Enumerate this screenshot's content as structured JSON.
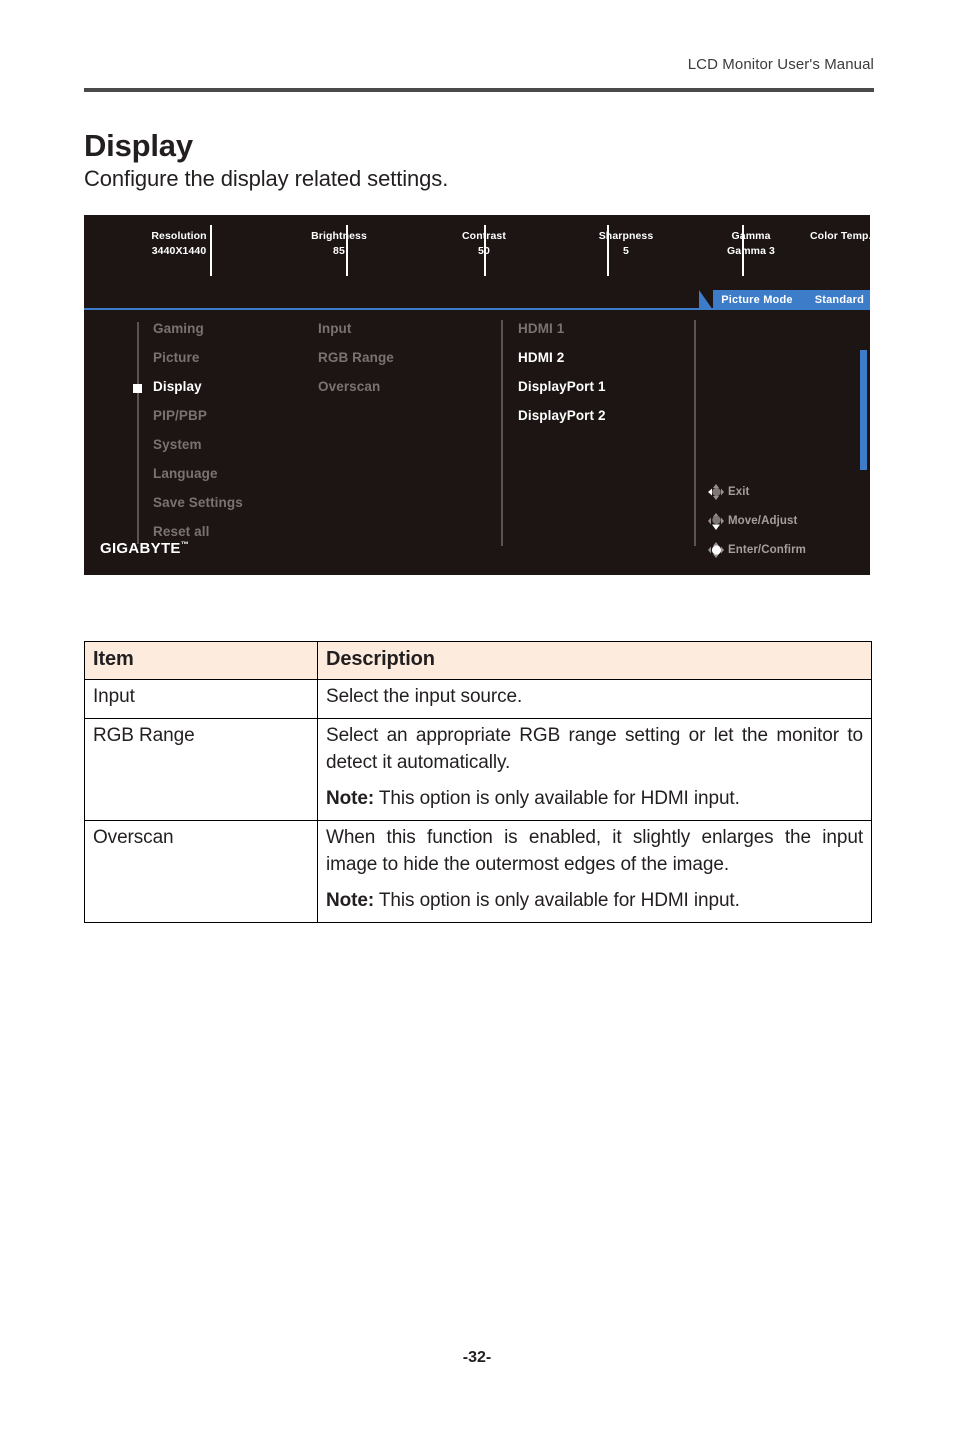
{
  "header": {
    "title": "LCD Monitor User's Manual"
  },
  "page": {
    "heading": "Display",
    "subheading": "Configure the display related settings.",
    "number": "-32-"
  },
  "osd": {
    "status_bar": [
      {
        "label": "Resolution",
        "value": "3440X1440"
      },
      {
        "label": "Brightness",
        "value": "85"
      },
      {
        "label": "Contrast",
        "value": "50"
      },
      {
        "label": "Sharpness",
        "value": "5"
      },
      {
        "label": "Gamma",
        "value": "Gamma 3"
      },
      {
        "label": "Color Temp. Normal",
        "value": ""
      }
    ],
    "picture_mode": {
      "label": "Picture Mode",
      "value": "Standard"
    },
    "main_menu": [
      {
        "label": "Gaming",
        "selected": false
      },
      {
        "label": "Picture",
        "selected": false
      },
      {
        "label": "Display",
        "selected": true
      },
      {
        "label": "PIP/PBP",
        "selected": false
      },
      {
        "label": "System",
        "selected": false
      },
      {
        "label": "Language",
        "selected": false
      },
      {
        "label": "Save Settings",
        "selected": false
      },
      {
        "label": "Reset all",
        "selected": false
      }
    ],
    "sub_menu": [
      {
        "label": "Input",
        "selected": false
      },
      {
        "label": "RGB Range",
        "selected": false
      },
      {
        "label": "Overscan",
        "selected": false
      }
    ],
    "options": [
      {
        "label": "HDMI 1",
        "selected": false
      },
      {
        "label": "HDMI 2",
        "selected": true
      },
      {
        "label": "DisplayPort 1",
        "selected": true
      },
      {
        "label": "DisplayPort 2",
        "selected": true
      }
    ],
    "hints": [
      {
        "label": "Exit",
        "direction": "left"
      },
      {
        "label": "Move/Adjust",
        "direction": "down"
      },
      {
        "label": "Enter/Confirm",
        "direction": "center"
      }
    ],
    "brand": "GIGABYTE",
    "brand_tm": "™",
    "colors": {
      "background": "#1c1514",
      "accent": "#3d7cc9",
      "dim_text": "#7b7270",
      "active_text": "#ffffff"
    }
  },
  "table": {
    "headers": [
      "Item",
      "Description"
    ],
    "header_bg": "#fdecdd",
    "rows": [
      {
        "item": "Input",
        "lines": [
          "Select the input source."
        ],
        "note_label": "",
        "note_text": ""
      },
      {
        "item": "RGB Range",
        "lines": [
          "Select an appropriate RGB range setting or let the monitor to detect it automatically."
        ],
        "note_label": "Note:",
        "note_text": " This option is only available for HDMI input."
      },
      {
        "item": "Overscan",
        "lines": [
          "When this function is enabled, it slightly enlarges the input image to hide the outermost edges of the image."
        ],
        "note_label": "Note:",
        "note_text": " This option is only available for HDMI input."
      }
    ]
  }
}
